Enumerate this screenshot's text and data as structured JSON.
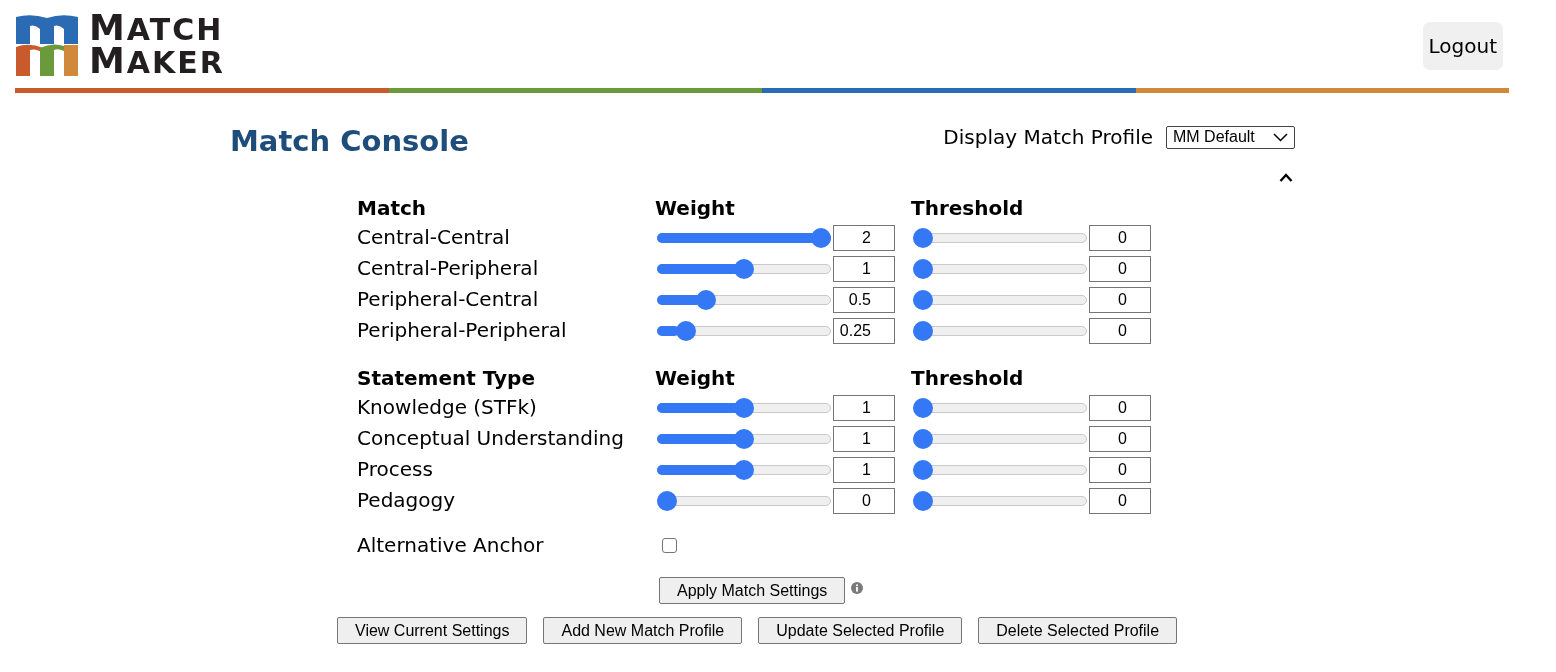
{
  "header": {
    "logo_lines": [
      "MATCH",
      "MAKER"
    ],
    "logout": "Logout"
  },
  "console": {
    "title": "Match Console",
    "profile_label": "Display Match Profile",
    "profile_value": "MM Default",
    "expanded": true
  },
  "sections": [
    {
      "heading": "Match",
      "weight_heading": "Weight",
      "threshold_heading": "Threshold",
      "rows": [
        {
          "label": "Central-Central",
          "weight": {
            "level": 1,
            "value": "2"
          },
          "threshold": {
            "level": 0,
            "value": "0"
          }
        },
        {
          "label": "Central-Peripheral",
          "weight": {
            "level": 0.5,
            "value": "1"
          },
          "threshold": {
            "level": 0,
            "value": "0"
          }
        },
        {
          "label": "Peripheral-Central",
          "weight": {
            "level": 0.25,
            "value": "0.5"
          },
          "threshold": {
            "level": 0,
            "value": "0"
          }
        },
        {
          "label": "Peripheral-Peripheral",
          "weight": {
            "level": 0.125,
            "value": "0.25"
          },
          "threshold": {
            "level": 0,
            "value": "0"
          }
        }
      ]
    },
    {
      "heading": "Statement Type",
      "weight_heading": "Weight",
      "threshold_heading": "Threshold",
      "rows": [
        {
          "label": "Knowledge (STFk)",
          "weight": {
            "level": 0.5,
            "value": "1"
          },
          "threshold": {
            "level": 0,
            "value": "0"
          }
        },
        {
          "label": "Conceptual Understanding",
          "weight": {
            "level": 0.5,
            "value": "1"
          },
          "threshold": {
            "level": 0,
            "value": "0"
          }
        },
        {
          "label": "Process",
          "weight": {
            "level": 0.5,
            "value": "1"
          },
          "threshold": {
            "level": 0,
            "value": "0"
          }
        },
        {
          "label": "Pedagogy",
          "weight": {
            "level": 0,
            "value": "0"
          },
          "threshold": {
            "level": 0,
            "value": "0"
          }
        }
      ]
    }
  ],
  "alternative_anchor": {
    "label": "Alternative Anchor",
    "checked": false
  },
  "apply_button": "Apply Match Settings",
  "actions": [
    "View Current Settings",
    "Add New Match Profile",
    "Update Selected Profile",
    "Delete Selected Profile"
  ]
}
